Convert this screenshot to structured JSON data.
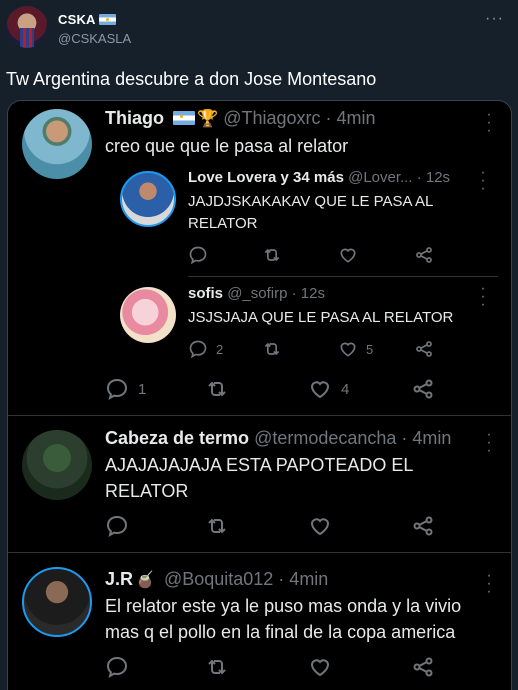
{
  "post": {
    "display_name": "CSKA",
    "handle": "@CSKASLA",
    "text": "Tw Argentina descubre a don Jose Montesano",
    "more_icon": "more-horizontal-icon"
  },
  "screenshot": {
    "replies": [
      {
        "name": "Thiago",
        "handle_time": "@Thiagoxrc · 4min",
        "text": "creo que que le pasa al relator",
        "counts": {
          "reply": "1",
          "retweet": "",
          "like": "4"
        },
        "nested": [
          {
            "name": "Love Lovera y 34 más",
            "handle_time": "@Lover... · 12s",
            "text_lines": [
              "JAJDJSKAKAKAV QUE LE PASA AL",
              "RELATOR"
            ],
            "counts": {
              "reply": "",
              "retweet": "",
              "like": ""
            }
          },
          {
            "name": "sofis",
            "handle_time": "@_sofirp · 12s",
            "text_lines": [
              "JSJSJAJA QUE LE PASA AL RELATOR"
            ],
            "counts": {
              "reply": "2",
              "retweet": "",
              "like": "5"
            }
          }
        ]
      },
      {
        "name": "Cabeza de termo",
        "handle_time": "@termodecancha · 4min",
        "text_lines": [
          "AJAJAJAJAJA ESTA PAPOTEADO EL",
          "RELATOR"
        ],
        "counts": {
          "reply": "",
          "retweet": "",
          "like": ""
        }
      },
      {
        "name": "J.R",
        "handle_time": "@Boquita012 · 4min",
        "text_lines": [
          "El relator este ya le puso mas onda y la vivio",
          "mas q el pollo en la final de la copa america"
        ],
        "counts": {
          "reply": "",
          "retweet": "",
          "like": ""
        }
      }
    ]
  },
  "colors": {
    "background": "#15202b",
    "screenshot_bg": "#000000",
    "muted": "#71767b",
    "text": "#e7e9ea"
  }
}
